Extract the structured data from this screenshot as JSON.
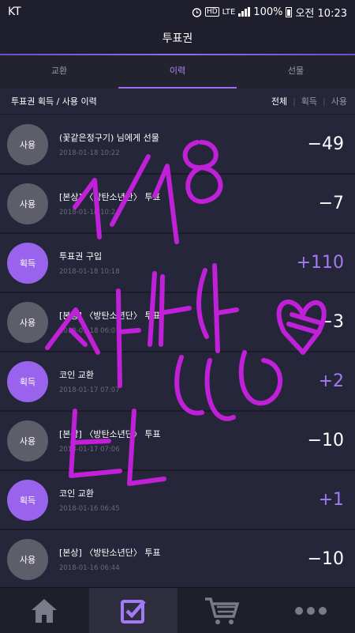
{
  "status": {
    "carrier": "KT",
    "hd": "HD",
    "network": "LTE",
    "battery": "100%",
    "time": "오전 10:23"
  },
  "header": {
    "title": "투표권"
  },
  "tabs": [
    {
      "label": "교환"
    },
    {
      "label": "이력",
      "active": true
    },
    {
      "label": "선물"
    }
  ],
  "history": {
    "heading": "투표권 획득 / 사용 이력",
    "filters": [
      "전체",
      "획득",
      "사용"
    ],
    "selected_filter": "전체"
  },
  "rows": [
    {
      "type": "사용",
      "title": "(꽃같은정구기) 님에게 선물",
      "date": "2018-01-18 10:22",
      "amount": "−49"
    },
    {
      "type": "사용",
      "title": "[본상] 〈방탄소년단〉 투표",
      "date": "2018-01-18 10:2",
      "amount": "−7"
    },
    {
      "type": "획득",
      "title": "투표권 구입",
      "date": "2018-01-18 10:18",
      "amount": "+110"
    },
    {
      "type": "사용",
      "title": "[본상] 〈방탄소년단〉 투표",
      "date": "2018-01-18 06:07",
      "amount": "−3"
    },
    {
      "type": "획득",
      "title": "코인 교환",
      "date": "2018-01-17 07:07",
      "amount": "+2"
    },
    {
      "type": "사용",
      "title": "[본상] 〈방탄소년단〉 투표",
      "date": "2018-01-17 07:06",
      "amount": "−10"
    },
    {
      "type": "획득",
      "title": "코인 교환",
      "date": "2018-01-16 06:45",
      "amount": "+1"
    },
    {
      "type": "사용",
      "title": "[본상] 〈방탄소년단〉 투표",
      "date": "2018-01-16 06:44",
      "amount": "−10"
    }
  ],
  "bottom_nav": [
    {
      "icon": "home-icon"
    },
    {
      "icon": "vote-check-icon",
      "active": true
    },
    {
      "icon": "cart-icon"
    },
    {
      "icon": "more-icon"
    }
  ],
  "colors": {
    "accent": "#9a63ee",
    "background": "#26263a",
    "handwriting": "#c020d8"
  }
}
